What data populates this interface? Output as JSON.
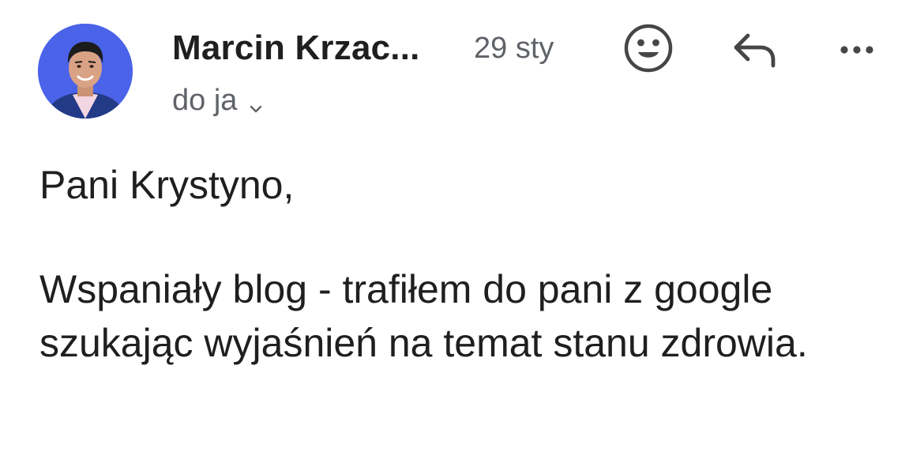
{
  "email": {
    "sender_name": "Marcin Krzac...",
    "date": "29 sty",
    "recipient": "do ja",
    "greeting": "Pani Krystyno,",
    "body_paragraph": "Wspaniały blog - trafiłem do pani z google szukając wyjaśnień na temat stanu zdrowia."
  },
  "icons": {
    "emoji": "smiley-icon",
    "reply": "reply-icon",
    "more": "more-horizontal-icon",
    "expand": "chevron-down-icon"
  },
  "colors": {
    "text_primary": "#1f1f1f",
    "text_secondary": "#5f6368",
    "avatar_background": "#4a63e8"
  }
}
